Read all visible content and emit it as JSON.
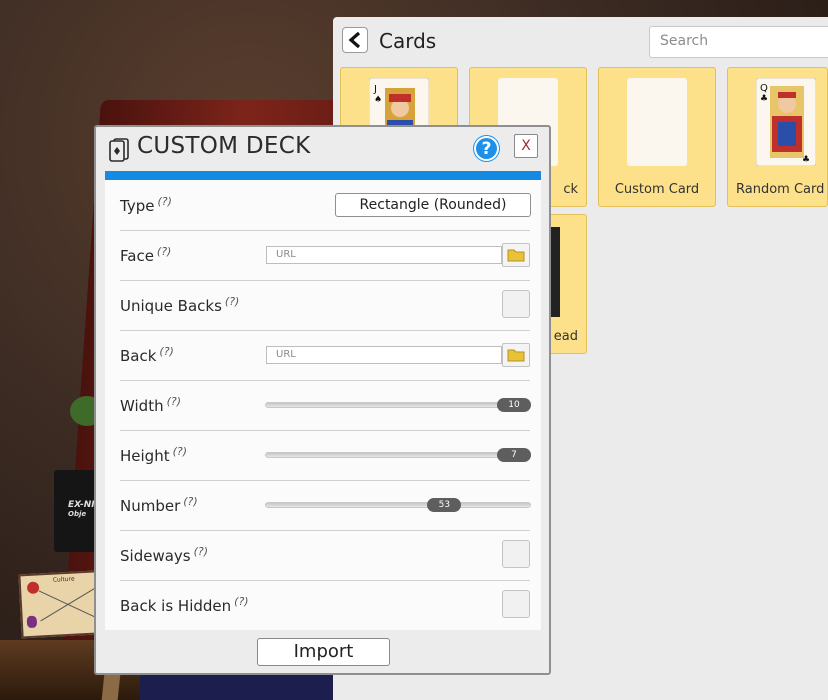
{
  "cards_panel": {
    "title": "Cards",
    "search_placeholder": "Search",
    "tiles": [
      {
        "label": ""
      },
      {
        "label": "ck"
      },
      {
        "label": "Custom Card"
      },
      {
        "label": "Random Card"
      },
      {
        "label": "ead"
      }
    ]
  },
  "dialog": {
    "title": "CUSTOM DECK",
    "help_label": "?",
    "close_label": "X",
    "hint": "(?)",
    "fields": {
      "type": {
        "label": "Type",
        "value": "Rectangle (Rounded)"
      },
      "face": {
        "label": "Face",
        "placeholder": "URL"
      },
      "unique_backs": {
        "label": "Unique Backs"
      },
      "back": {
        "label": "Back",
        "placeholder": "URL"
      },
      "width": {
        "label": "Width",
        "value": "10",
        "fraction": 1.0
      },
      "height": {
        "label": "Height",
        "value": "7",
        "fraction": 1.0
      },
      "number": {
        "label": "Number",
        "value": "53",
        "fraction": 0.7
      },
      "sideways": {
        "label": "Sideways"
      },
      "back_is_hidden": {
        "label": "Back is Hidden"
      }
    },
    "import_label": "Import"
  },
  "scene": {
    "book_text_line1": "EX-NI",
    "book_text_line2": "Obje",
    "board_text": "Culture"
  },
  "colors": {
    "accent": "#148ae3",
    "tile_bg": "#fde08a",
    "slider_handle": "#5e5e5e",
    "help_button": "#1e90e8"
  }
}
